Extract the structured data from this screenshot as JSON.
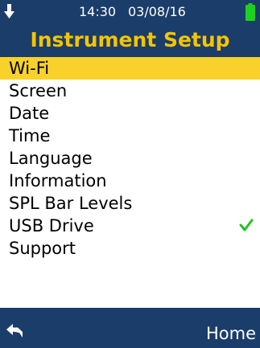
{
  "status_bar": {
    "time": "14:30",
    "date": "03/08/16",
    "left_icon": "download-arrow-icon",
    "battery_icon": "battery-icon",
    "battery_color": "#20d020"
  },
  "header": {
    "title": "Instrument Setup",
    "title_color": "#f5c400",
    "background": "#1b3d6a"
  },
  "menu": {
    "selected_index": 0,
    "highlight_color": "#f8d22a",
    "items": [
      {
        "label": "Wi-Fi"
      },
      {
        "label": "Screen"
      },
      {
        "label": "Date"
      },
      {
        "label": "Time"
      },
      {
        "label": "Language"
      },
      {
        "label": "Information"
      },
      {
        "label": "SPL Bar Levels"
      },
      {
        "label": "USB Drive",
        "checked": true,
        "check_icon": "checkmark-icon",
        "check_color": "#1fc41f"
      },
      {
        "label": "Support"
      }
    ]
  },
  "footer": {
    "back_icon": "back-arrow-icon",
    "home_label": "Home"
  }
}
